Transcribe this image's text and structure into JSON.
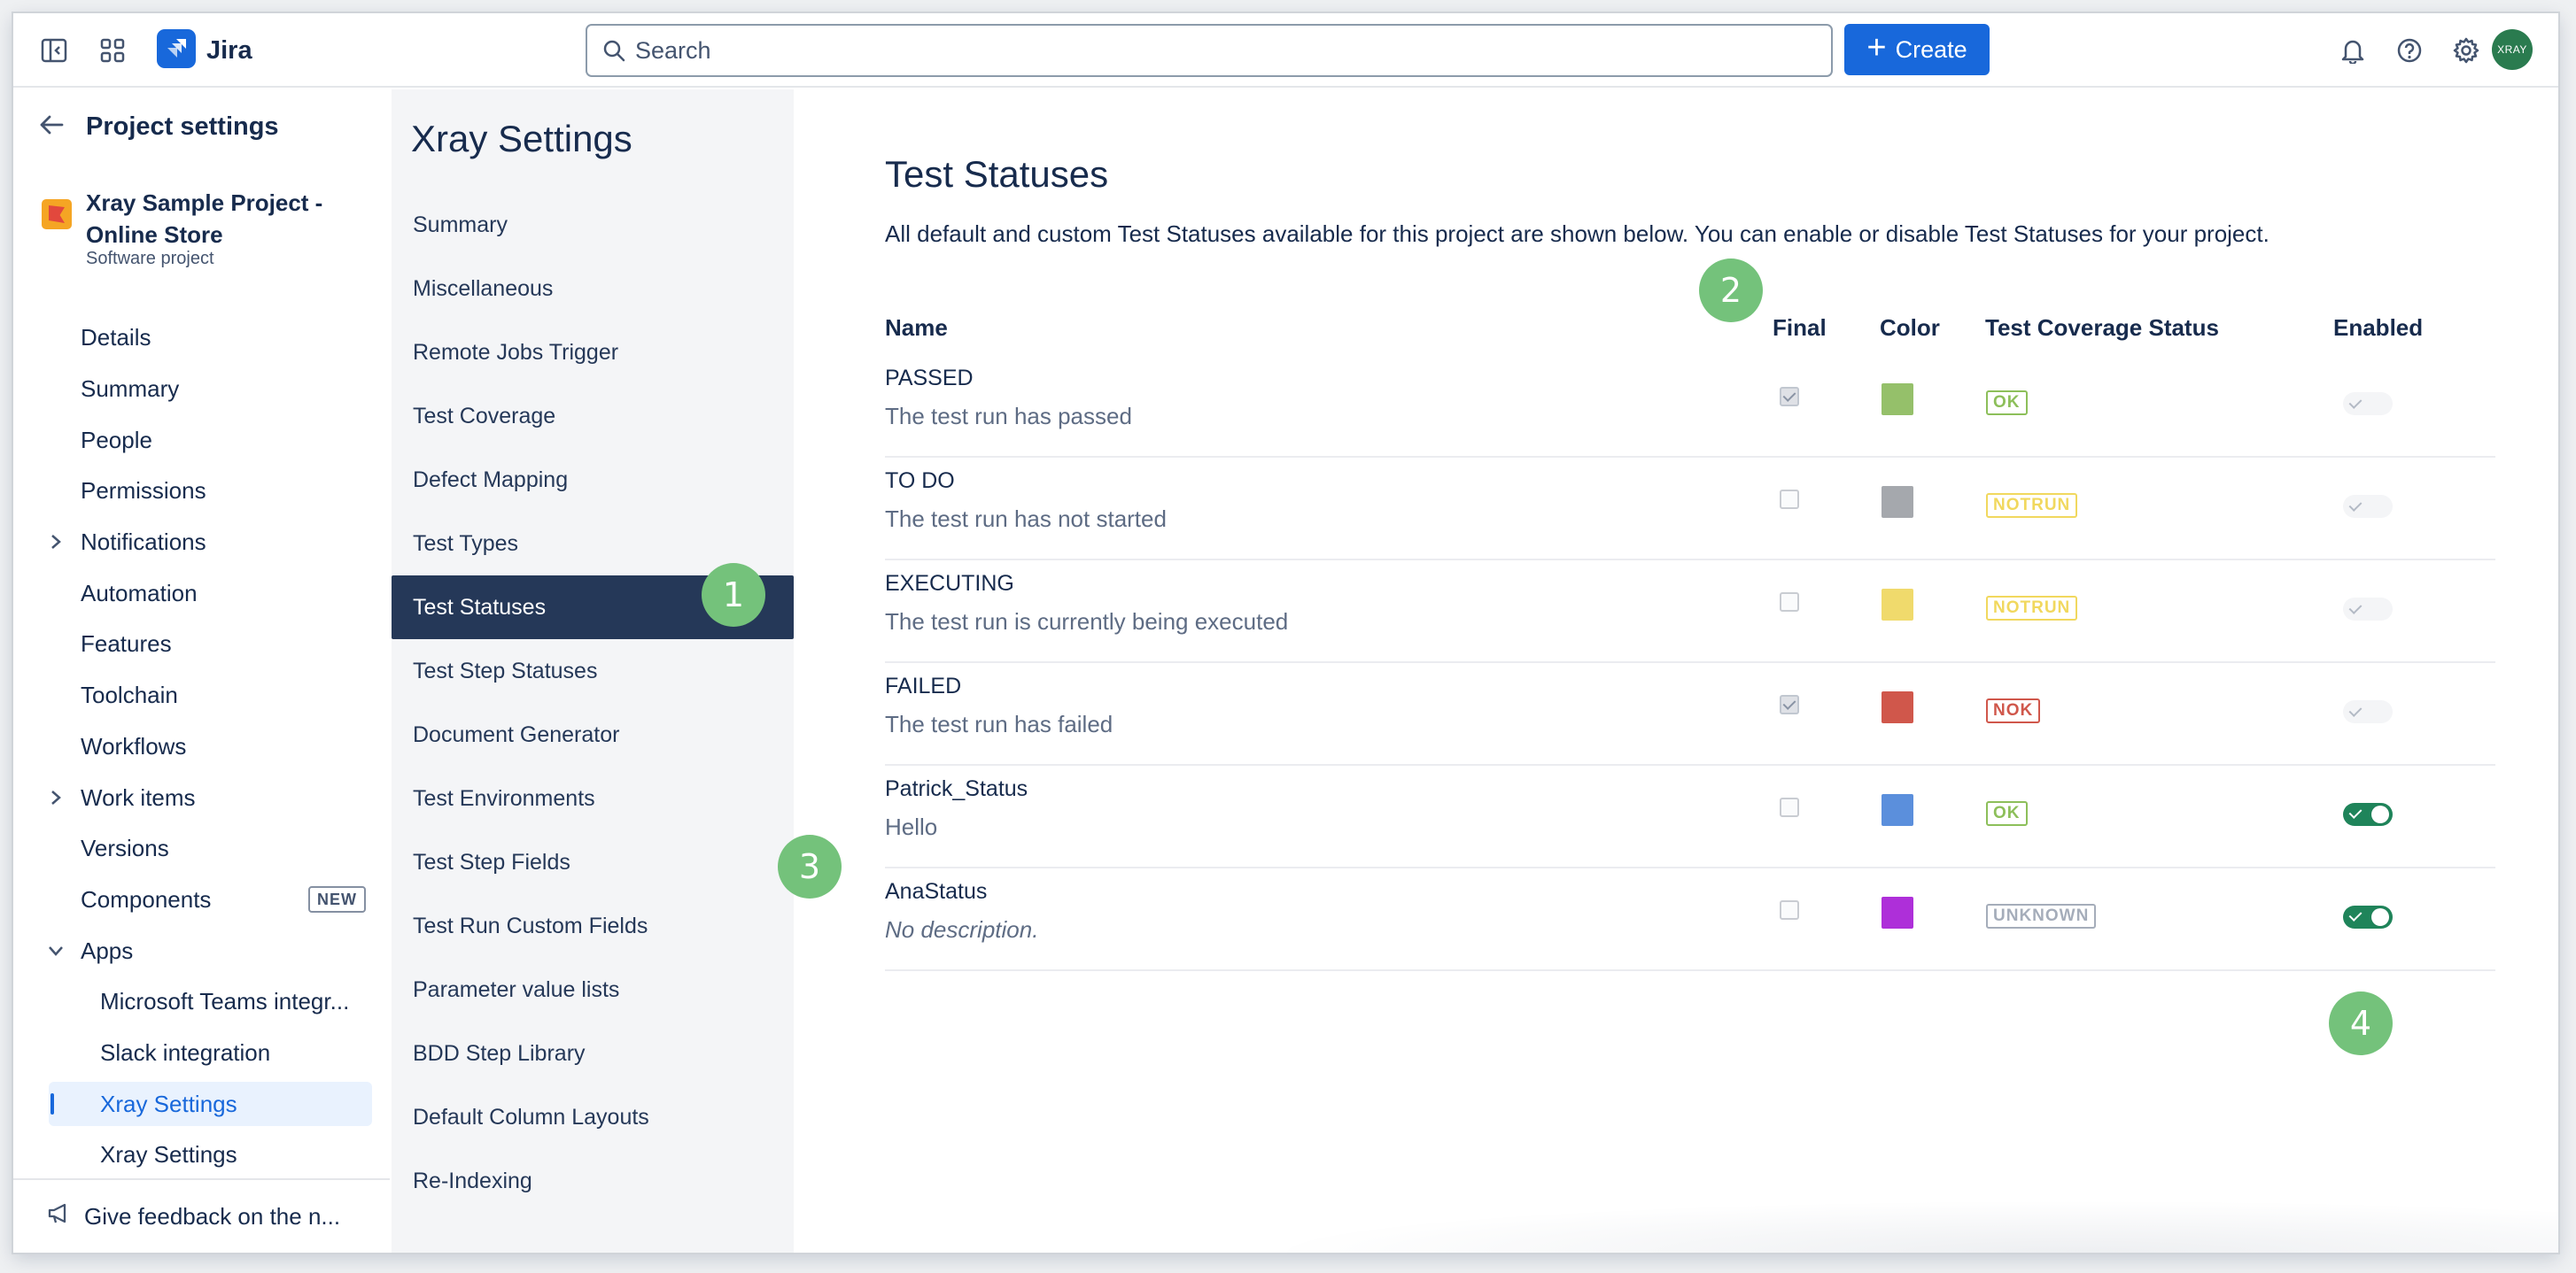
{
  "app": {
    "name": "Jira",
    "search_placeholder": "Search",
    "create_label": "Create",
    "avatar_text": "XRAY",
    "brand_color": "#1868db"
  },
  "sidebar": {
    "back_title": "Project settings",
    "project_name": "Xray Sample Project - Online Store",
    "project_type": "Software project",
    "items": [
      {
        "label": "Details"
      },
      {
        "label": "Summary"
      },
      {
        "label": "People"
      },
      {
        "label": "Permissions"
      },
      {
        "label": "Notifications"
      },
      {
        "label": "Automation"
      },
      {
        "label": "Features"
      },
      {
        "label": "Toolchain"
      },
      {
        "label": "Workflows"
      },
      {
        "label": "Work items"
      },
      {
        "label": "Versions"
      },
      {
        "label": "Components",
        "badge": "NEW"
      },
      {
        "label": "Apps"
      }
    ],
    "app_items": [
      {
        "label": "Microsoft Teams integr..."
      },
      {
        "label": "Slack integration"
      },
      {
        "label": "Xray Settings",
        "active": true
      },
      {
        "label": "Xray Settings"
      }
    ],
    "feedback_label": "Give feedback on the n..."
  },
  "xray": {
    "title": "Xray Settings",
    "items": [
      "Summary",
      "Miscellaneous",
      "Remote Jobs Trigger",
      "Test Coverage",
      "Defect Mapping",
      "Test Types",
      "Test Statuses",
      "Test Step Statuses",
      "Document Generator",
      "Test Environments",
      "Test Step Fields",
      "Test Run Custom Fields",
      "Parameter value lists",
      "BDD Step Library",
      "Default Column Layouts",
      "Re-Indexing"
    ],
    "active_item": "Test Statuses"
  },
  "main": {
    "title": "Test Statuses",
    "description": "All default and custom Test Statuses available for this project are shown below. You can enable or disable Test Statuses for your project.",
    "columns": {
      "name": "Name",
      "final": "Final",
      "color": "Color",
      "coverage": "Test Coverage Status",
      "enabled": "Enabled"
    },
    "rows": [
      {
        "name": "PASSED",
        "description": "The test run has passed",
        "final": true,
        "color": "#95c06a",
        "coverage": "OK",
        "coverage_color": "#8dbf5a",
        "enabled": true,
        "editable": false
      },
      {
        "name": "TO DO",
        "description": "The test run has not started",
        "final": false,
        "color": "#a5a8ad",
        "coverage": "NOTRUN",
        "coverage_color": "#f1d85e",
        "enabled": true,
        "editable": false
      },
      {
        "name": "EXECUTING",
        "description": "The test run is currently being executed",
        "final": false,
        "color": "#f0da6c",
        "coverage": "NOTRUN",
        "coverage_color": "#f1d85e",
        "enabled": true,
        "editable": false
      },
      {
        "name": "FAILED",
        "description": "The test run has failed",
        "final": true,
        "color": "#d0574b",
        "coverage": "NOK",
        "coverage_color": "#d0574b",
        "enabled": true,
        "editable": false
      },
      {
        "name": "Patrick_Status",
        "description": "Hello",
        "final": false,
        "color": "#5b8fdc",
        "coverage": "OK",
        "coverage_color": "#8dbf5a",
        "enabled": true,
        "editable": true
      },
      {
        "name": "AnaStatus",
        "description": "No description.",
        "description_italic": true,
        "final": false,
        "color": "#ae2fd9",
        "coverage": "UNKNOWN",
        "coverage_color": "#a5adba",
        "enabled": true,
        "editable": true
      }
    ]
  },
  "markers": [
    "1",
    "2",
    "3",
    "4"
  ],
  "marker_color": "#74c27b"
}
